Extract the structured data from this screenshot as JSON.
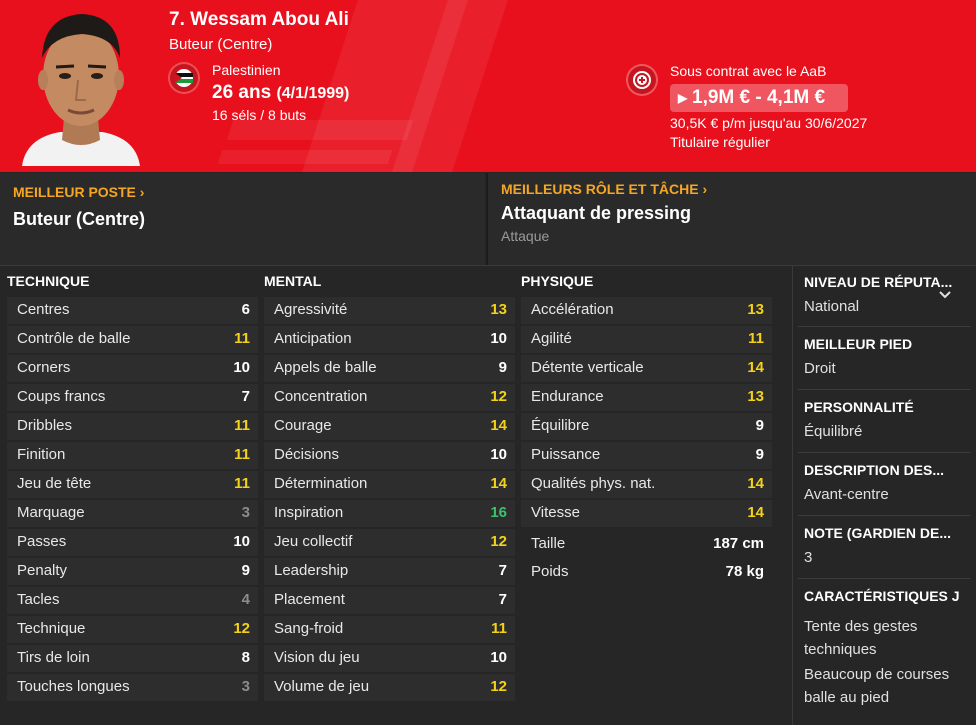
{
  "player": {
    "name": "7. Wessam Abou Ali",
    "position": "Buteur (Centre)",
    "nationality": "Palestinien",
    "age": "26 ans",
    "birthdate": "(4/1/1999)",
    "caps": "16 séls / 8 buts"
  },
  "contract": {
    "club_line": "Sous contrat avec le AaB",
    "value": "1,9M € - 4,1M €",
    "wage": "30,5K € p/m jusqu'au 30/6/2027",
    "status": "Titulaire régulier"
  },
  "best_position": {
    "title": "MEILLEUR POSTE",
    "value": "Buteur (Centre)"
  },
  "best_role": {
    "title": "MEILLEURS RÔLE ET TÂCHE",
    "value": "Attaquant de pressing",
    "duty": "Attaque"
  },
  "technique": {
    "title": "TECHNIQUE",
    "rows": [
      {
        "label": "Centres",
        "value": "6",
        "tone": "white"
      },
      {
        "label": "Contrôle de balle",
        "value": "11",
        "tone": "yellow"
      },
      {
        "label": "Corners",
        "value": "10",
        "tone": "white"
      },
      {
        "label": "Coups francs",
        "value": "7",
        "tone": "white"
      },
      {
        "label": "Dribbles",
        "value": "11",
        "tone": "yellow"
      },
      {
        "label": "Finition",
        "value": "11",
        "tone": "yellow"
      },
      {
        "label": "Jeu de tête",
        "value": "11",
        "tone": "yellow"
      },
      {
        "label": "Marquage",
        "value": "3",
        "tone": "grey"
      },
      {
        "label": "Passes",
        "value": "10",
        "tone": "white"
      },
      {
        "label": "Penalty",
        "value": "9",
        "tone": "white"
      },
      {
        "label": "Tacles",
        "value": "4",
        "tone": "grey"
      },
      {
        "label": "Technique",
        "value": "12",
        "tone": "yellow"
      },
      {
        "label": "Tirs de loin",
        "value": "8",
        "tone": "white"
      },
      {
        "label": "Touches longues",
        "value": "3",
        "tone": "grey"
      }
    ]
  },
  "mental": {
    "title": "MENTAL",
    "rows": [
      {
        "label": "Agressivité",
        "value": "13",
        "tone": "yellow"
      },
      {
        "label": "Anticipation",
        "value": "10",
        "tone": "white"
      },
      {
        "label": "Appels de balle",
        "value": "9",
        "tone": "white"
      },
      {
        "label": "Concentration",
        "value": "12",
        "tone": "yellow"
      },
      {
        "label": "Courage",
        "value": "14",
        "tone": "yellow"
      },
      {
        "label": "Décisions",
        "value": "10",
        "tone": "white"
      },
      {
        "label": "Détermination",
        "value": "14",
        "tone": "yellow"
      },
      {
        "label": "Inspiration",
        "value": "16",
        "tone": "green"
      },
      {
        "label": "Jeu collectif",
        "value": "12",
        "tone": "yellow"
      },
      {
        "label": "Leadership",
        "value": "7",
        "tone": "white"
      },
      {
        "label": "Placement",
        "value": "7",
        "tone": "white"
      },
      {
        "label": "Sang-froid",
        "value": "11",
        "tone": "yellow"
      },
      {
        "label": "Vision du jeu",
        "value": "10",
        "tone": "white"
      },
      {
        "label": "Volume de jeu",
        "value": "12",
        "tone": "yellow"
      }
    ]
  },
  "physique": {
    "title": "PHYSIQUE",
    "rows": [
      {
        "label": "Accélération",
        "value": "13",
        "tone": "yellow"
      },
      {
        "label": "Agilité",
        "value": "11",
        "tone": "yellow"
      },
      {
        "label": "Détente verticale",
        "value": "14",
        "tone": "yellow"
      },
      {
        "label": "Endurance",
        "value": "13",
        "tone": "yellow"
      },
      {
        "label": "Équilibre",
        "value": "9",
        "tone": "white"
      },
      {
        "label": "Puissance",
        "value": "9",
        "tone": "white"
      },
      {
        "label": "Qualités phys. nat.",
        "value": "14",
        "tone": "yellow"
      },
      {
        "label": "Vitesse",
        "value": "14",
        "tone": "yellow"
      }
    ],
    "height_label": "Taille",
    "height_value": "187 cm",
    "weight_label": "Poids",
    "weight_value": "78 kg"
  },
  "side": {
    "reputation_title": "NIVEAU DE RÉPUTA...",
    "reputation_value": "National",
    "foot_title": "MEILLEUR PIED",
    "foot_value": "Droit",
    "personality_title": "PERSONNALITÉ",
    "personality_value": "Équilibré",
    "description_title": "DESCRIPTION DES...",
    "description_value": "Avant-centre",
    "rating_title": "NOTE (GARDIEN DE...",
    "rating_value": "3",
    "traits_title": "CARACTÉRISTIQUES J",
    "traits": [
      "Tente des gestes techniques",
      "Beaucoup de courses balle au pied"
    ]
  },
  "colors": {
    "header_red": "#e8101c",
    "accent_orange": "#f5a623",
    "value_yellow": "#f3d218",
    "value_green": "#3ac36a",
    "value_grey": "#8c8c8c"
  },
  "icons": {
    "flag": "palestine-flag-icon",
    "club": "aab-club-badge-icon",
    "chevron": "chevron-right-icon",
    "dropdown": "chevron-down-icon"
  }
}
